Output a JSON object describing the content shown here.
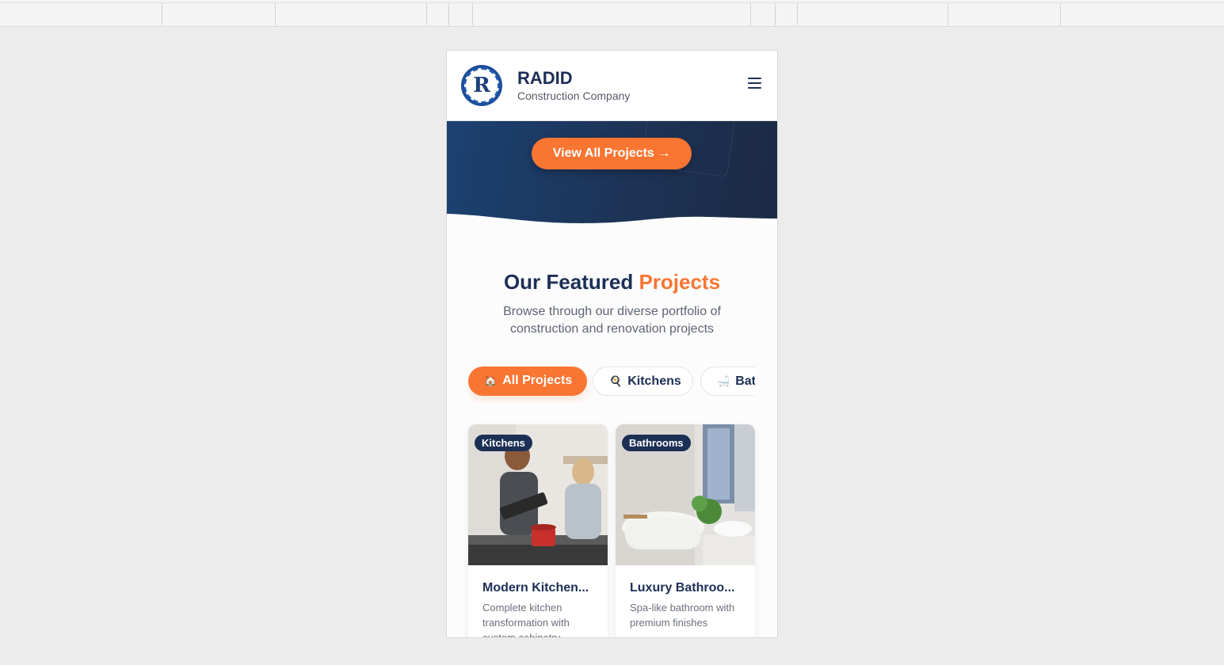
{
  "brand": {
    "name": "RADID",
    "tagline": "Construction Company",
    "logo_letter": "R",
    "logo_icon": "company-seal-logo",
    "accent_color": "#f97532",
    "navy_color": "#1c2f55"
  },
  "header": {
    "menu_icon": "hamburger-menu-icon"
  },
  "hero": {
    "cta_label": "View All Projects →"
  },
  "projects": {
    "title_main": "Our Featured",
    "title_accent": "Projects",
    "subtitle": "Browse through our diverse portfolio of construction and renovation projects",
    "filters": [
      {
        "icon": "🏠",
        "label": "All Projects",
        "active": true
      },
      {
        "icon": "🍳",
        "label": "Kitchens",
        "active": false
      },
      {
        "icon": "🛁",
        "label": "Bat",
        "active": false
      }
    ],
    "cards": [
      {
        "category": "Kitchens",
        "title": "Modern Kitchen...",
        "description": "Complete kitchen transformation with custom cabinetry"
      },
      {
        "category": "Bathrooms",
        "title": "Luxury Bathroo...",
        "description": "Spa-like bathroom with premium finishes"
      }
    ]
  }
}
